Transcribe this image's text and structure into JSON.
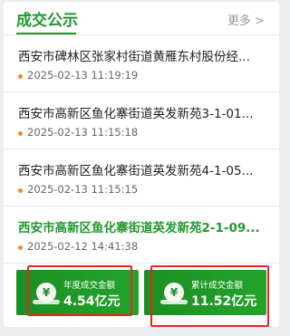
{
  "header": {
    "title": "成交公示",
    "more_label": "更多 >"
  },
  "items": [
    {
      "title": "西安市碑林区张家村街道黄雁东村股份经...",
      "time": "2025-02-13 11:19:19"
    },
    {
      "title": "西安市高新区鱼化寨街道英发新苑3-1-01...",
      "time": "2025-02-13 11:15:18"
    },
    {
      "title": "西安市高新区鱼化寨街道英发新苑4-1-05...",
      "time": "2025-02-13 11:15:15"
    },
    {
      "title": "西安市高新区鱼化寨街道英发新苑2-1-09...",
      "time": "2025-02-12 14:41:38"
    }
  ],
  "stats": [
    {
      "label": "年度成交金额",
      "value": "4.54亿元",
      "icon": "yuan-coin-icon"
    },
    {
      "label": "累计成交金额",
      "value": "11.52亿元",
      "icon": "yuan-coin-icon"
    }
  ],
  "colors": {
    "accent": "#1f9a2c",
    "highlight": "#e6271f",
    "dot": "#f08a24"
  }
}
